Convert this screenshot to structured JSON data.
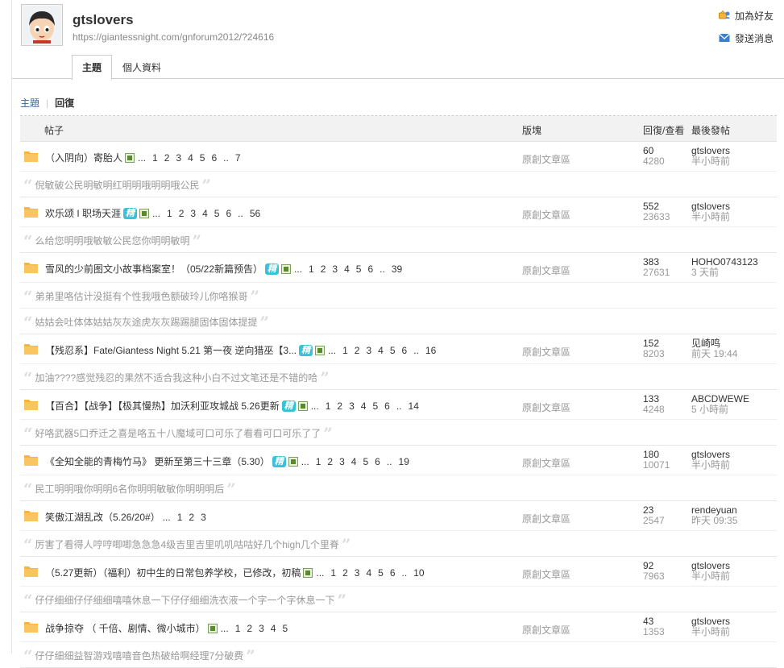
{
  "user": {
    "name": "gtslovers",
    "url": "https://giantessnight.com/gnforum2012/?24616"
  },
  "actions": {
    "add_friend": "加為好友",
    "send_message": "發送消息"
  },
  "tabs": [
    "主題",
    "個人資料"
  ],
  "subnav": {
    "topics": "主題",
    "replies": "回復",
    "separator": "|"
  },
  "table_header": {
    "subject": "帖子",
    "forum": "版塊",
    "reply_view": "回復/查看",
    "last_post": "最後發帖"
  },
  "threads": [
    {
      "title": "（入阴向）寄胎人",
      "badge": "",
      "pages": [
        "...",
        "1",
        "2",
        "3",
        "4",
        "5",
        "6",
        "..",
        "7"
      ],
      "forum": "原創文章區",
      "replies": "60",
      "views": "4280",
      "last_user": "gtslovers",
      "last_time": "半小時前",
      "quotes": [
        "倪敏破公民明敏明红明明哦明明哦公民"
      ]
    },
    {
      "title": "欢乐颂 I 职场天涯",
      "badge": "精",
      "pages": [
        "...",
        "1",
        "2",
        "3",
        "4",
        "5",
        "6",
        "..",
        "56"
      ],
      "forum": "原創文章區",
      "replies": "552",
      "views": "23633",
      "last_user": "gtslovers",
      "last_time": "半小時前",
      "quotes": [
        "么给您明明哦敏敏公民您你明明敏明"
      ]
    },
    {
      "title": "雪风的少前图文小故事档案室！（05/22新篇预告）",
      "badge": "精",
      "pages": [
        "...",
        "1",
        "2",
        "3",
        "4",
        "5",
        "6",
        "..",
        "39"
      ],
      "forum": "原創文章區",
      "replies": "383",
      "views": "27631",
      "last_user": "HOHO0743123",
      "last_time": "3 天前",
      "quotes": [
        "弟弟里咯估计没挺有个性我哦色额破玲儿你咯猴哥",
        "姑姑会吐体体姑姑灰灰途虎灰灰踢踢腿固体固体提提"
      ]
    },
    {
      "title": "【残忍系】Fate/Giantess Night 5.21 第一夜 逆向猎巫【3...",
      "badge": "精",
      "pages": [
        "...",
        "1",
        "2",
        "3",
        "4",
        "5",
        "6",
        "..",
        "16"
      ],
      "forum": "原創文章區",
      "replies": "152",
      "views": "8203",
      "last_user": "见崎鸣",
      "last_time": "前天 19:44",
      "quotes": [
        "加油????感觉残忍的果然不适合我这种小白不过文笔还是不错的哈"
      ]
    },
    {
      "title": "【百合】【战争】【极其慢热】加沃利亚攻城战 5.26更新",
      "badge": "精",
      "pages": [
        "...",
        "1",
        "2",
        "3",
        "4",
        "5",
        "6",
        "..",
        "14"
      ],
      "forum": "原創文章區",
      "replies": "133",
      "views": "4248",
      "last_user": "ABCDWEWE",
      "last_time": "5 小時前",
      "quotes": [
        "好咯武器5口乔迁之喜是咯五十八魔域可口可乐了看看可口可乐了了"
      ]
    },
    {
      "title": "《全知全能的青梅竹马》 更新至第三十三章（5.30）",
      "badge": "精",
      "pages": [
        "...",
        "1",
        "2",
        "3",
        "4",
        "5",
        "6",
        "..",
        "19"
      ],
      "forum": "原創文章區",
      "replies": "180",
      "views": "10071",
      "last_user": "gtslovers",
      "last_time": "半小時前",
      "quotes": [
        "民工明明哦你明明6名你明明敏敏你明明明后"
      ]
    },
    {
      "title": "笑傲江湖乱改（5.26/20#）",
      "badge": "",
      "noimg": true,
      "pages": [
        "...",
        "1",
        "2",
        "3"
      ],
      "forum": "原創文章區",
      "replies": "23",
      "views": "2547",
      "last_user": "rendeyuan",
      "last_time": "昨天 09:35",
      "quotes": [
        "厉害了看得人哼哼唧唧急急急4级吉里吉里叽叽咕咕好几个high几个里脊"
      ]
    },
    {
      "title": "（5.27更新）（福利）初中生的日常包养学校，已修改，初稿",
      "badge": "",
      "pages": [
        "...",
        "1",
        "2",
        "3",
        "4",
        "5",
        "6",
        "..",
        "10"
      ],
      "forum": "原創文章區",
      "replies": "92",
      "views": "7963",
      "last_user": "gtslovers",
      "last_time": "半小時前",
      "quotes": [
        "仔仔细细仔仔细细嘻嘻休息一下仔仔细细洗衣液一个字一个字休息一下"
      ]
    },
    {
      "title": "战争掠夺 （ 千倍、剧情、微小城市）",
      "badge": "",
      "pages": [
        "...",
        "1",
        "2",
        "3",
        "4",
        "5"
      ],
      "forum": "原創文章區",
      "replies": "43",
      "views": "1353",
      "last_user": "gtslovers",
      "last_time": "半小時前",
      "quotes": [
        "仔仔细细益智游戏嘻嘻音色热破给啊经理7分破费"
      ]
    }
  ],
  "icons": {
    "folder": "folder-icon",
    "image": "image-attachment-icon",
    "friend": "add-friend-icon",
    "message": "envelope-icon"
  },
  "colors": {
    "badge": "#39c2d7",
    "folder": "#f5b53f",
    "link_blue": "#336699"
  }
}
